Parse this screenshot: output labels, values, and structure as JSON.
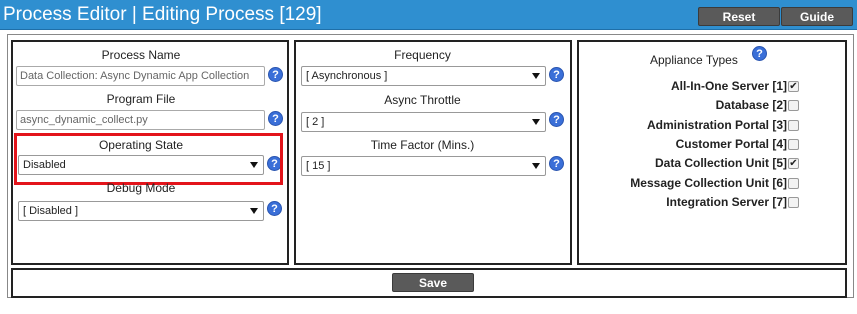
{
  "header": {
    "title": "Process Editor | Editing Process [129]",
    "reset_label": "Reset",
    "guide_label": "Guide"
  },
  "col1": {
    "process_name_label": "Process Name",
    "process_name_value": "Data Collection: Async Dynamic App Collection",
    "program_file_label": "Program File",
    "program_file_value": "async_dynamic_collect.py",
    "operating_state_label": "Operating State",
    "operating_state_value": "Disabled",
    "debug_mode_label": "Debug Mode",
    "debug_mode_value": "[ Disabled ]"
  },
  "col2": {
    "frequency_label": "Frequency",
    "frequency_value": "[ Asynchronous ]",
    "async_throttle_label": "Async Throttle",
    "async_throttle_value": "[ 2 ]",
    "time_factor_label": "Time Factor (Mins.)",
    "time_factor_value": "[ 15 ]"
  },
  "col3": {
    "title": "Appliance Types",
    "items": [
      {
        "label": "All-In-One Server [1]",
        "checked": true
      },
      {
        "label": "Database [2]",
        "checked": false
      },
      {
        "label": "Administration Portal [3]",
        "checked": false
      },
      {
        "label": "Customer Portal [4]",
        "checked": false
      },
      {
        "label": "Data Collection Unit [5]",
        "checked": true
      },
      {
        "label": "Message Collection Unit [6]",
        "checked": false
      },
      {
        "label": "Integration Server [7]",
        "checked": false
      }
    ]
  },
  "footer": {
    "save_label": "Save"
  },
  "icons": {
    "help": "help-icon",
    "dropdown": "chevron-down-icon",
    "checkmark": "check-icon"
  },
  "colors": {
    "titlebar": "#2f8fd0",
    "button": "#5a5a5a",
    "help": "#3a6fd8",
    "highlight": "#e3141b"
  }
}
